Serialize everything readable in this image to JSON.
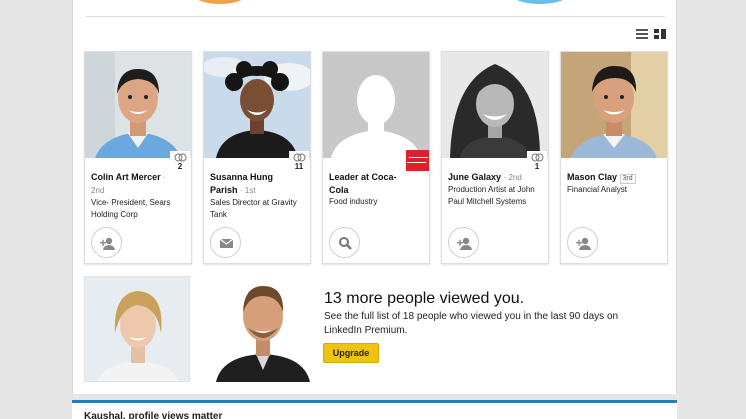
{
  "viewers": [
    {
      "name": "Colin Art Mercer",
      "degree": "2nd",
      "title": "Vice- President, Sears Holding Corp",
      "shared_connections": "2",
      "action_icon": "add-connection-icon"
    },
    {
      "name": "Susanna Hung Parish",
      "degree": "1st",
      "title": "Sales Director at Gravity Tank",
      "shared_connections": "11",
      "action_icon": "message-icon"
    },
    {
      "name": "Leader at Coca-Cola",
      "degree": "",
      "title": "Food industry",
      "shared_connections": "",
      "action_icon": "search-icon"
    },
    {
      "name": "June Galaxy",
      "degree": "2nd",
      "title": "Production Artist at John Paul Mitchell Systems",
      "shared_connections": "1",
      "action_icon": "add-connection-icon"
    },
    {
      "name": "Mason Clay",
      "degree": "3rd",
      "title": "Financial Analyst",
      "shared_connections": "",
      "action_icon": "add-connection-icon"
    }
  ],
  "more": {
    "title": "13 more people viewed you.",
    "description": "See the full list of 18 people who viewed you in the last 90 days on LinkedIn Premium.",
    "upgrade_label": "Upgrade"
  },
  "bottom": {
    "text": "Kaushal, profile views matter"
  },
  "colors": {
    "accent_blue": "#2b7bb9",
    "upgrade_yellow": "#f0c30f",
    "coke_red": "#d8232a"
  }
}
